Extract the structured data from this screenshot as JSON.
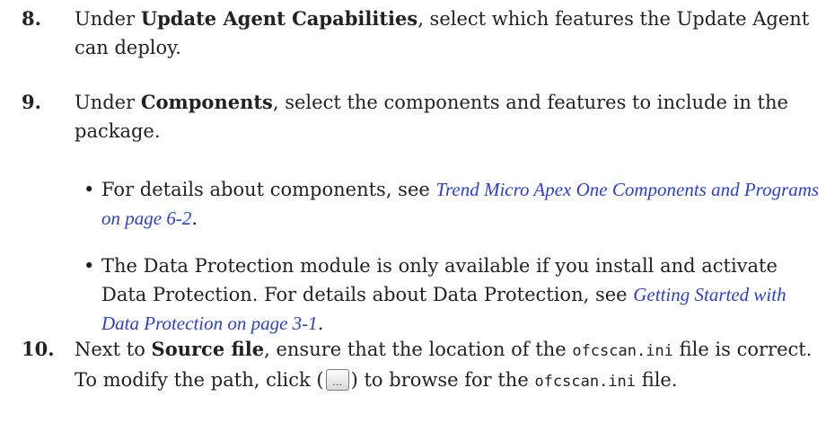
{
  "steps": [
    {
      "number": "8.",
      "pre": "Under ",
      "bold": "Update Agent Capabilities",
      "post": ", select which features the Update Agent can deploy."
    },
    {
      "number": "9.",
      "pre": "Under ",
      "bold": "Components",
      "post": ", select the components and features to include in the package."
    },
    {
      "number": "10.",
      "pre": "Next to ",
      "bold": "Source file",
      "mid1": ", ensure that the location of the ",
      "code1": "ofcscan.ini",
      "mid2": " file is correct. To modify the path, click (",
      "mid3": ") to browse for the ",
      "code2": "ofcscan.ini",
      "post": " file."
    }
  ],
  "bullets": [
    {
      "pre": "For details about components, see ",
      "link": "Trend Micro Apex One Components and Programs on page 6-2",
      "post": "."
    },
    {
      "pre": "The Data Protection module is only available if you install and activate Data Protection. For details about Data Protection, see ",
      "link": "Getting Started with Data Protection on page 3-1",
      "post": "."
    }
  ],
  "browse_button": {
    "label": "..."
  }
}
